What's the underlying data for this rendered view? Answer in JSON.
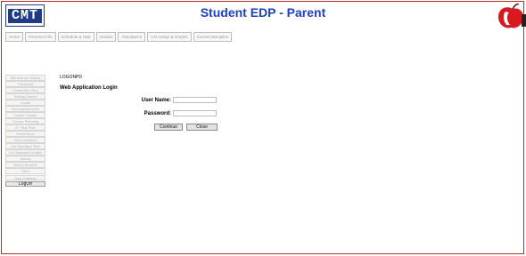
{
  "header": {
    "logo_text": "CMT",
    "title": "Student EDP - Parent"
  },
  "tabs": [
    {
      "label": "Home"
    },
    {
      "label": "Personal Info"
    },
    {
      "label": "Schedule & Hwk"
    },
    {
      "label": "Grades"
    },
    {
      "label": "Attendance"
    },
    {
      "label": "Cal Assign & Grades"
    },
    {
      "label": "Current Discipline"
    }
  ],
  "sidebar": {
    "items": [
      {
        "label": "Attendance History"
      },
      {
        "label": "Transcript"
      },
      {
        "label": "Graduation Req"
      },
      {
        "label": "Testing Scores"
      },
      {
        "label": "Goals"
      },
      {
        "label": "Accomplishments"
      },
      {
        "label": "Career Cluster"
      },
      {
        "label": "Course Planning"
      },
      {
        "label": "4+ Year Plan"
      },
      {
        "label": "Email Book"
      },
      {
        "label": "Immunizations"
      },
      {
        "label": "Cal Standard Fset"
      },
      {
        "label": "Cal Standard Grades"
      },
      {
        "label": "Survey"
      },
      {
        "label": "Select Student"
      },
      {
        "label": "Print"
      },
      {
        "label": "User Settings"
      },
      {
        "label": "LogOff"
      }
    ]
  },
  "main": {
    "breadcrumb": "LOGONPD",
    "heading": "Web Application Login",
    "username_label": "User Name:",
    "username_value": "",
    "password_label": "Password:",
    "password_value": "",
    "continue_label": "Continue",
    "close_label": "Close"
  }
}
